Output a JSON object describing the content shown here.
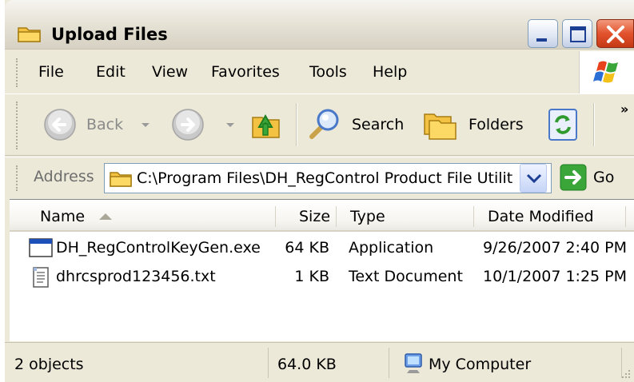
{
  "window": {
    "title": "Upload Files"
  },
  "menubar": {
    "items": [
      "File",
      "Edit",
      "View",
      "Favorites",
      "Tools",
      "Help"
    ]
  },
  "toolbar": {
    "back_label": "Back",
    "search_label": "Search",
    "folders_label": "Folders"
  },
  "addressbar": {
    "label": "Address",
    "value": "C:\\Program Files\\DH_RegControl Product File Utilit",
    "go_label": "Go"
  },
  "filelist": {
    "columns": [
      "Name",
      "Size",
      "Type",
      "Date Modified"
    ],
    "rows": [
      {
        "name": "DH_RegControlKeyGen.exe",
        "size": "64 KB",
        "type": "Application",
        "date": "9/26/2007 2:40 PM",
        "icon": "application-icon"
      },
      {
        "name": "dhrcsprod123456.txt",
        "size": "1 KB",
        "type": "Text Document",
        "date": "10/1/2007 1:25 PM",
        "icon": "text-file-icon"
      }
    ]
  },
  "statusbar": {
    "objects": "2 objects",
    "size": "64.0 KB",
    "zone": "My Computer"
  },
  "colors": {
    "chrome": "#ece9d8",
    "address_border": "#7f9db9",
    "close_red": "#e2522d",
    "go_green": "#3aa63a"
  }
}
